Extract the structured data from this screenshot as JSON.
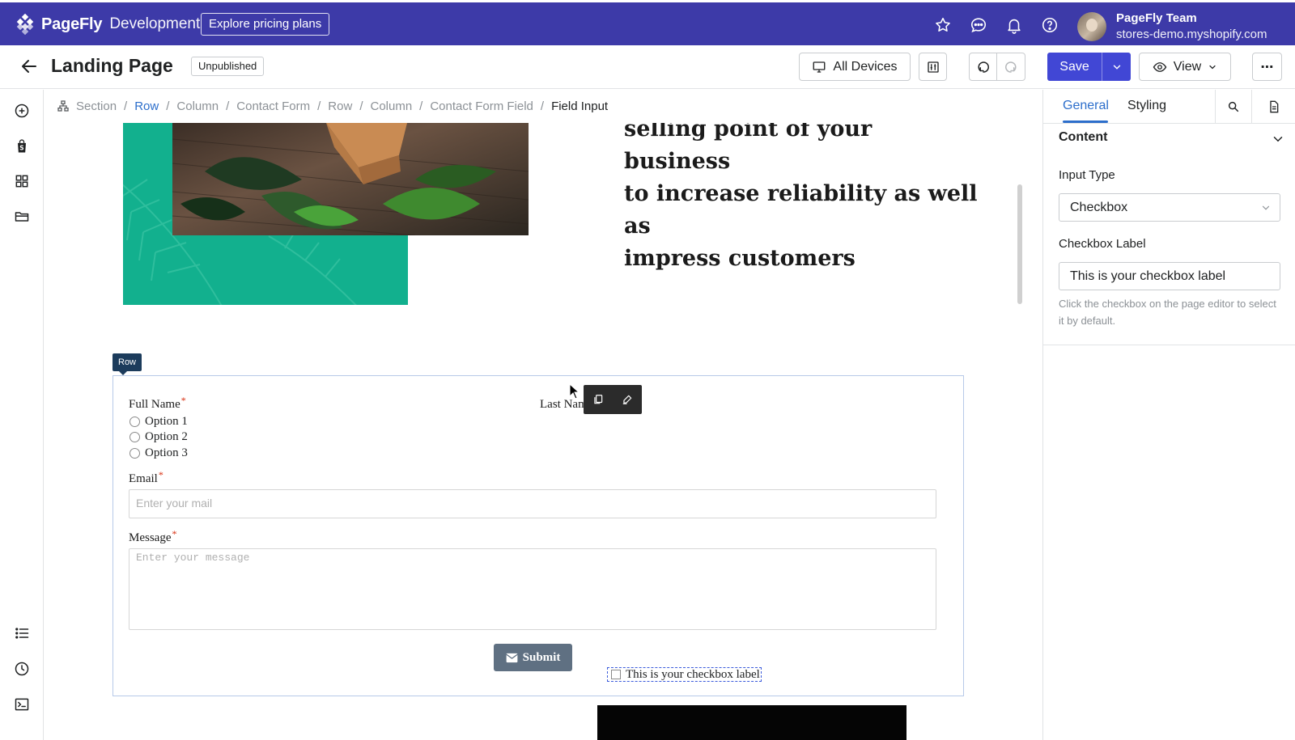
{
  "topbar": {
    "brand": "PageFly",
    "brand_suffix": "Development",
    "pricing_label": "Explore pricing plans",
    "team_name": "PageFly Team",
    "store_domain": "stores-demo.myshopify.com"
  },
  "pagebar": {
    "title": "Landing Page",
    "status": "Unpublished",
    "devices_label": "All Devices",
    "save_label": "Save",
    "view_label": "View",
    "more_label": "⋯"
  },
  "breadcrumb": {
    "items": [
      "Section",
      "Row",
      "Column",
      "Contact Form",
      "Row",
      "Column",
      "Contact Form Field",
      "Field Input"
    ],
    "separator": "/"
  },
  "canvas": {
    "hero_line1": "selling point of your business",
    "hero_line2": "to increase reliability as well as",
    "hero_line3": "impress customers",
    "row_tag": "Row",
    "form": {
      "full_name_label": "Full Name",
      "required_mark": "*",
      "options": [
        "Option 1",
        "Option 2",
        "Option 3"
      ],
      "last_name_label": "Last Nam",
      "checkbox_label": "This is your checkbox label",
      "email_label": "Email",
      "email_placeholder": "Enter your mail",
      "message_label": "Message",
      "message_placeholder": "Enter your message",
      "submit_label": "Submit"
    }
  },
  "panel": {
    "tabs": [
      "General",
      "Styling"
    ],
    "active_tab": "General",
    "section_title": "Content",
    "input_type_label": "Input Type",
    "input_type_value": "Checkbox",
    "checkbox_label_label": "Checkbox Label",
    "checkbox_label_value": "This is your checkbox label",
    "help_text": "Click the checkbox on the page editor to select it by default."
  },
  "colors": {
    "topbar": "#3d3aa8",
    "primary": "#4147d5",
    "link": "#2c6ecb",
    "teal": "#12b08e",
    "required": "#d72c0d"
  }
}
